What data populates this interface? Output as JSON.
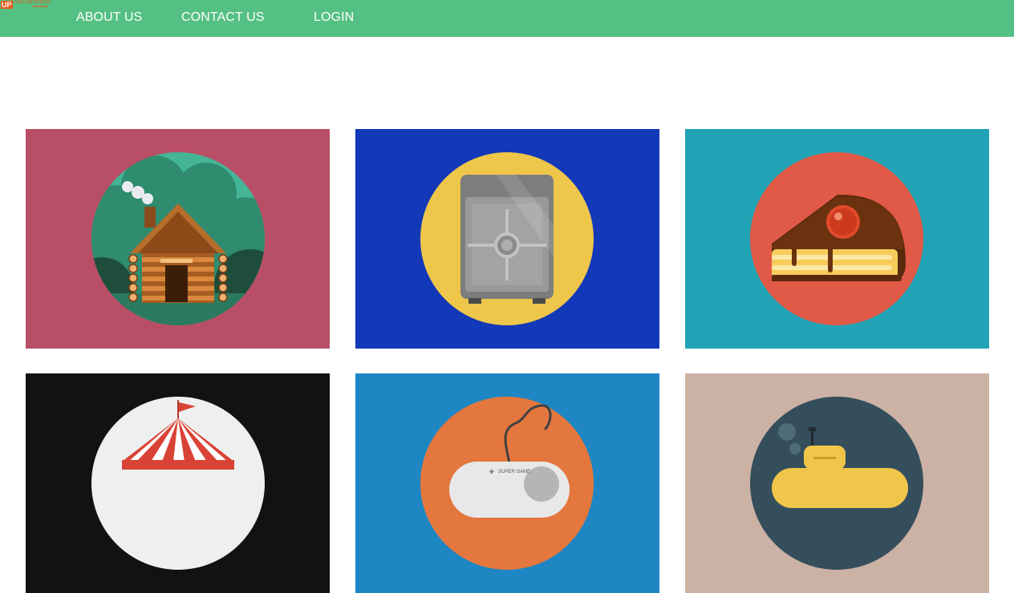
{
  "brand": {
    "logo_mark": "UP",
    "logo_text": "SARKARI PORTAL"
  },
  "nav": {
    "items": [
      {
        "label": "ABOUT US"
      },
      {
        "label": "CONTACT US"
      },
      {
        "label": "LOGIN"
      }
    ]
  },
  "colors": {
    "navbar": "#55c083",
    "tile_cabin": "#b94f66",
    "tile_safe": "#1338b8",
    "tile_cake": "#21a3b5",
    "tile_circus": "#141111",
    "tile_gamepad": "#1f86c4",
    "tile_submarine": "#cbb2a5"
  },
  "gallery": {
    "tiles": [
      {
        "icon": "log-cabin-icon"
      },
      {
        "icon": "safe-icon"
      },
      {
        "icon": "cake-slice-icon"
      },
      {
        "icon": "circus-tent-icon"
      },
      {
        "icon": "game-controller-icon",
        "controller_text": "SUPER GAME"
      },
      {
        "icon": "submarine-icon"
      }
    ]
  }
}
